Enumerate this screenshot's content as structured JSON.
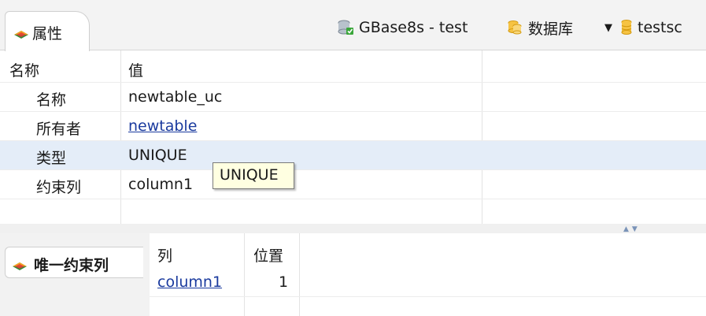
{
  "tab": {
    "label": "属性",
    "icon": "properties-icon"
  },
  "breadcrumb": {
    "connection": "GBase8s - test",
    "database_label": "数据库",
    "database_value": "testsc"
  },
  "props": {
    "header": {
      "name": "名称",
      "value": "值"
    },
    "rows": [
      {
        "key": "名称",
        "value": "newtable_uc",
        "link": false
      },
      {
        "key": "所有者",
        "value": "newtable",
        "link": true
      },
      {
        "key": "类型",
        "value": "UNIQUE",
        "link": false,
        "selected": true
      },
      {
        "key": "约束列",
        "value": "column1",
        "link": false
      }
    ],
    "tooltip": "UNIQUE"
  },
  "lower": {
    "tab_label": "唯一约束列",
    "columns": {
      "col": "列",
      "position": "位置"
    },
    "rows": [
      {
        "col": "column1",
        "position": "1"
      }
    ]
  },
  "colors": {
    "selected_row": "#e4edf8",
    "link": "#1a3a9e",
    "tooltip_bg": "#ffffe1"
  }
}
